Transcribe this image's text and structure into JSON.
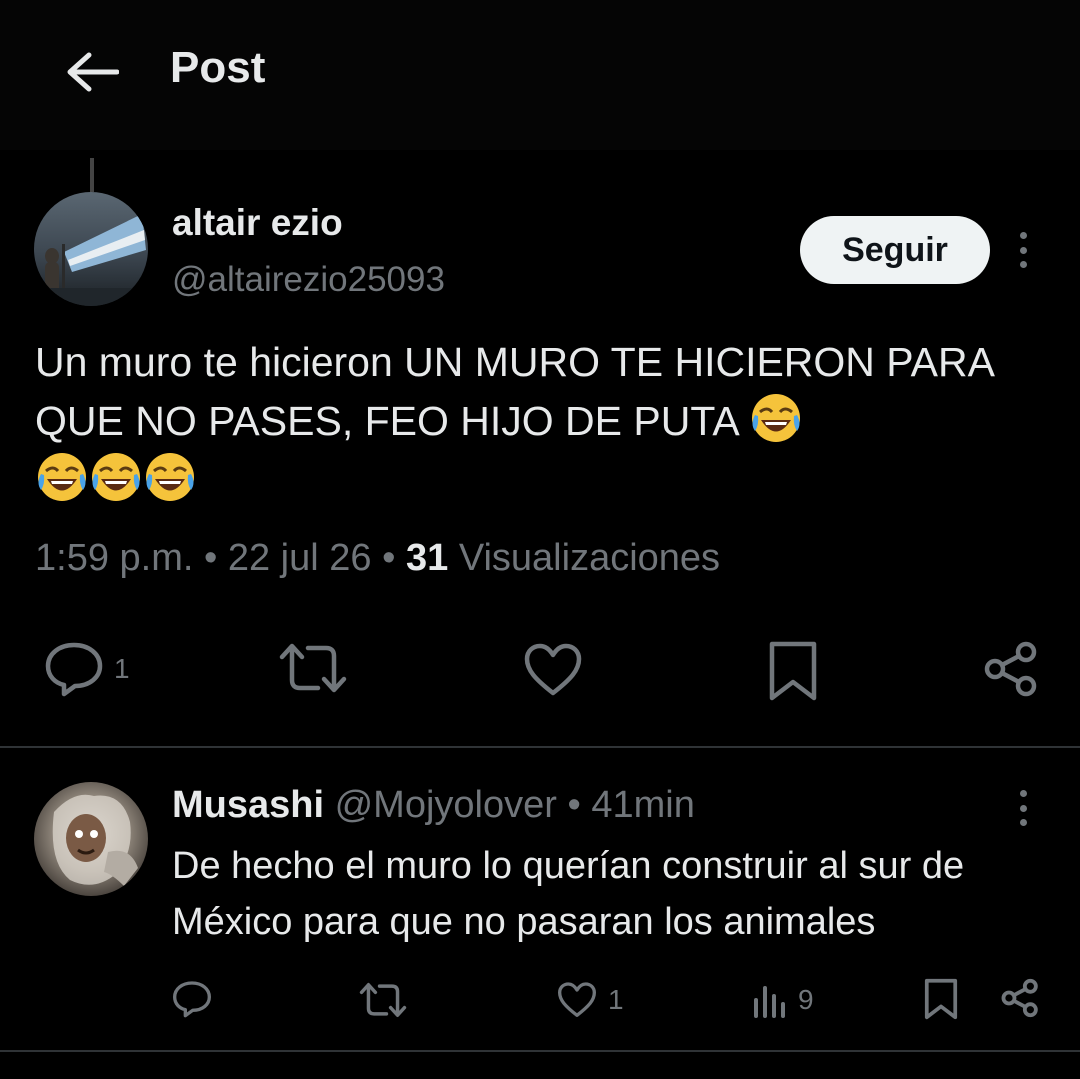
{
  "header": {
    "title": "Post"
  },
  "post": {
    "author_name": "altair ezio",
    "author_handle": "@altairezio25093",
    "follow_label": "Seguir",
    "text": "Un muro te hicieron UN MURO TE HICIERON PARA QUE NO PASES,  FEO HIJO DE PUTA",
    "time": "1:59 p.m.",
    "date": "22 jul 26",
    "views_count": "31",
    "views_label": "Visualizaciones",
    "reply_count": "1"
  },
  "reply": {
    "author_name": "Musashi",
    "author_handle": "@Mojyolover",
    "age": "41min",
    "text": "De hecho el muro lo querían construir al sur de México para que no pasaran los animales",
    "like_count": "1",
    "view_count": "9"
  },
  "icons": {
    "back": "arrow-left-icon",
    "reply": "speech-bubble-icon",
    "repost": "repost-icon",
    "like": "heart-icon",
    "bookmark": "bookmark-icon",
    "share": "share-icon",
    "views": "bar-chart-icon",
    "more": "vertical-dots-icon",
    "emoji": "face-with-tears-of-joy"
  },
  "colors": {
    "background": "#000000",
    "text_primary": "#e7e9ea",
    "text_secondary": "#71767b",
    "follow_button": "#eff3f4",
    "divider": "#2f3336"
  }
}
